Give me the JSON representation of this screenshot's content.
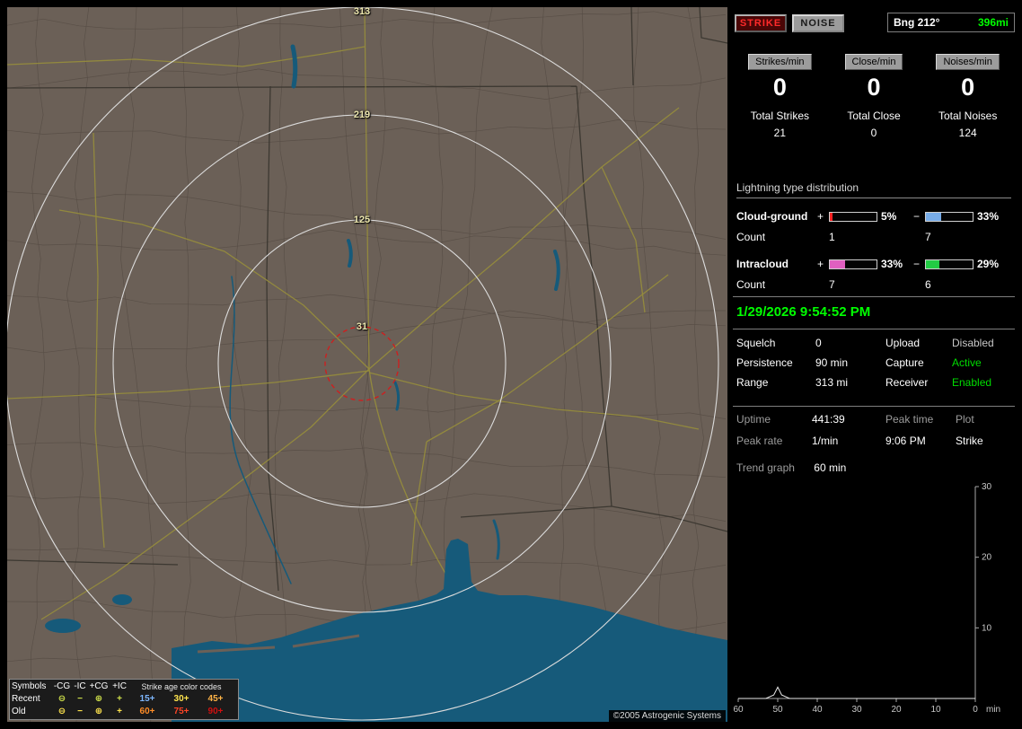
{
  "colors": {
    "accent-green": "#00ff00",
    "map-land": "#6b6057",
    "map-county": "#554b43",
    "map-state": "#3a362f",
    "map-road": "#958b3d",
    "map-water": "#165a7a",
    "ring": "#dcdcdc",
    "ring-label": "#ece6ae",
    "close-ring": "#cc2020"
  },
  "header": {
    "strike_button": "STRIKE",
    "noise_button": "NOISE",
    "bearing_label": "Bng 212°",
    "bearing_distance": "396mi"
  },
  "counters": [
    {
      "label": "Strikes/min",
      "value": "0",
      "total_label": "Total Strikes",
      "total_value": "21"
    },
    {
      "label": "Close/min",
      "value": "0",
      "total_label": "Total Close",
      "total_value": "0"
    },
    {
      "label": "Noises/min",
      "value": "0",
      "total_label": "Total Noises",
      "total_value": "124"
    }
  ],
  "distribution": {
    "title": "Lightning type distribution",
    "rows": [
      {
        "label": "Cloud-ground",
        "pos_sign": "+",
        "pos_pct": 5,
        "pos_label": "5%",
        "pos_color": "#ff2222",
        "neg_sign": "−",
        "neg_pct": 33,
        "neg_label": "33%",
        "neg_color": "#77ace8",
        "count_label": "Count",
        "pos_count": "1",
        "neg_count": "7"
      },
      {
        "label": "Intracloud",
        "pos_sign": "+",
        "pos_pct": 33,
        "pos_label": "33%",
        "pos_color": "#e060c0",
        "neg_sign": "−",
        "neg_pct": 29,
        "neg_label": "29%",
        "neg_color": "#22cc44",
        "count_label": "Count",
        "pos_count": "7",
        "neg_count": "6"
      }
    ]
  },
  "status": {
    "datetime": "1/29/2026 9:54:52 PM",
    "settings": [
      {
        "label": "Squelch",
        "value": "0"
      },
      {
        "label": "Persistence",
        "value": "90 min"
      },
      {
        "label": "Range",
        "value": "313 mi"
      }
    ],
    "states": [
      {
        "label": "Upload",
        "value": "Disabled",
        "color": "#c8c8c8"
      },
      {
        "label": "Capture",
        "value": "Active",
        "color": "#00dd00"
      },
      {
        "label": "Receiver",
        "value": "Enabled",
        "color": "#00dd00"
      }
    ],
    "stats": {
      "uptime_label": "Uptime",
      "uptime_value": "441:39",
      "peak_rate_label": "Peak rate",
      "peak_rate_value": "1/min",
      "peak_time_label": "Peak time",
      "peak_time_value": "9:06 PM",
      "plot_label": "Plot",
      "plot_value": "Strike"
    },
    "trend_label": "Trend graph",
    "trend_value": "60 min"
  },
  "trend_graph": {
    "type": "line",
    "series_name": "Strike rate",
    "x_unit": "min",
    "x_ticks": [
      60,
      50,
      40,
      30,
      20,
      10,
      0
    ],
    "y_ticks": [
      10,
      20,
      30
    ],
    "ylim": [
      0,
      30
    ],
    "xlim_minutes_ago": [
      60,
      0
    ],
    "points": [
      [
        60,
        0
      ],
      [
        53,
        0
      ],
      [
        51,
        0.5
      ],
      [
        50,
        1.6
      ],
      [
        49,
        0.5
      ],
      [
        47,
        0
      ],
      [
        0,
        0
      ]
    ]
  },
  "map": {
    "rings": [
      {
        "label": "313"
      },
      {
        "label": "219"
      },
      {
        "label": "125"
      },
      {
        "label": "31"
      }
    ],
    "copyright": "©2005 Astrogenic Systems"
  },
  "legend": {
    "symbols_header": "Symbols",
    "type_headers": [
      "-CG",
      "-IC",
      "+CG",
      "+IC"
    ],
    "age_header": "Strike age color codes",
    "symbols": [
      "⊖",
      "−",
      "⊕",
      "+"
    ],
    "rows": [
      {
        "label": "Recent",
        "symbol_color": "#cfe04a",
        "ages": [
          {
            "text": "15+",
            "color": "#7db6ff"
          },
          {
            "text": "30+",
            "color": "#ffe44d"
          },
          {
            "text": "45+",
            "color": "#ffb347"
          }
        ]
      },
      {
        "label": "Old",
        "symbol_color": "#ffe44d",
        "ages": [
          {
            "text": "60+",
            "color": "#ff8c26"
          },
          {
            "text": "75+",
            "color": "#ff4526"
          },
          {
            "text": "90+",
            "color": "#d01010"
          }
        ]
      }
    ]
  }
}
